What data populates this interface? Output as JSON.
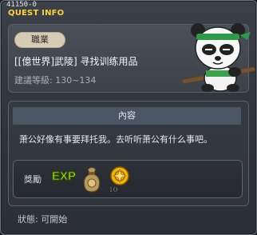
{
  "window": {
    "quest_id": "41150-0",
    "title": "QUEST INFO"
  },
  "quest": {
    "job_tag": "職業",
    "title": "[[億世界]武陵] 寻找训练用品",
    "level_req": "建議等級: 130~134"
  },
  "content": {
    "header": "內容",
    "text": "萧公好像有事要拜托我。去听听萧公有什么事吧。"
  },
  "reward": {
    "label": "獎勵",
    "items": [
      {
        "name": "exp-icon",
        "text": "EXP"
      },
      {
        "name": "money-bag-icon"
      },
      {
        "name": "gold-coin-icon",
        "count": "10"
      }
    ]
  },
  "status": {
    "text": "狀態: 可開始"
  },
  "colors": {
    "title_yellow": "#ffd23f",
    "panel_bg": "#3d424a",
    "header_bg": "#4a5663"
  }
}
